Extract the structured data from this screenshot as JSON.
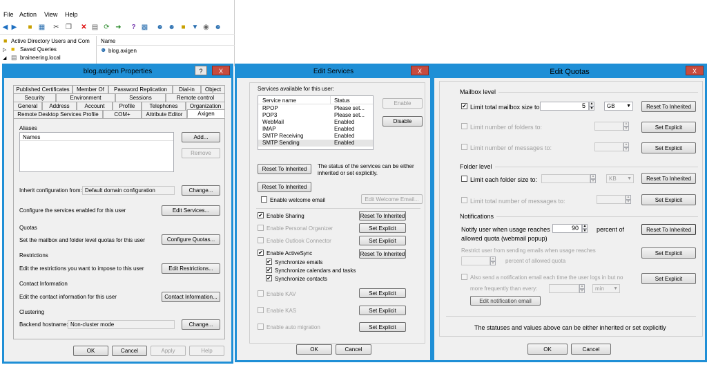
{
  "mmc": {
    "menu": [
      "File",
      "Action",
      "View",
      "Help"
    ],
    "tree": [
      "Active Directory Users and Com",
      "Saved Queries",
      "braineering.local"
    ],
    "list_header": "Name",
    "list_item": "blog.axigen"
  },
  "props": {
    "title": "blog.axigen Properties",
    "help_glyph": "?",
    "close_glyph": "X",
    "tabs_row1": [
      "Published Certificates",
      "Member Of",
      "Password Replication",
      "Dial-in",
      "Object"
    ],
    "tabs_row2": [
      "Security",
      "Environment",
      "Sessions",
      "Remote control"
    ],
    "tabs_row3": [
      "General",
      "Address",
      "Account",
      "Profile",
      "Telephones",
      "Organization"
    ],
    "tabs_row4": [
      "Remote Desktop Services Profile",
      "COM+",
      "Attribute Editor",
      "Axigen"
    ],
    "aliases_label": "Aliases",
    "names_header": "Names",
    "add": "Add...",
    "remove": "Remove",
    "inherit_label": "Inherit configuration from:",
    "inherit_value": "Default domain configuration",
    "change": "Change...",
    "services_text": "Configure the services enabled for this user",
    "edit_services": "Edit Services...",
    "quotas_label": "Quotas",
    "quotas_text": "Set the mailbox and  folder level quotas for this user",
    "configure_quotas": "Configure Quotas...",
    "restrictions_label": "Restrictions",
    "restrictions_text": "Edit the restrictions you want to impose to this user",
    "edit_restrictions": "Edit Restrictions...",
    "contact_label": "Contact Information",
    "contact_text": "Edit the contact information for this user",
    "contact_btn": "Contact Information...",
    "clustering_label": "Clustering",
    "backend_label": "Backend hostname:",
    "backend_value": "Non-cluster mode",
    "change2": "Change...",
    "ok": "OK",
    "cancel": "Cancel",
    "apply": "Apply",
    "help": "Help"
  },
  "services": {
    "title": "Edit Services",
    "close_glyph": "X",
    "avail_label": "Services available for this user:",
    "col_name": "Service name",
    "col_status": "Status",
    "rows": [
      {
        "name": "RPOP",
        "status": "Please set..."
      },
      {
        "name": "POP3",
        "status": "Please set..."
      },
      {
        "name": "WebMail",
        "status": "Enabled"
      },
      {
        "name": "IMAP",
        "status": "Enabled"
      },
      {
        "name": "SMTP Receiving",
        "status": "Enabled"
      },
      {
        "name": "SMTP Sending",
        "status": "Enabled"
      }
    ],
    "enable": "Enable",
    "disable": "Disable",
    "reset_inherited": "Reset To Inherited",
    "status_note": "The status of the services can be either inherited or set explicitly.",
    "reset_inherited2": "Reset To Inherited",
    "welcome_email": "Enable welcome email",
    "edit_welcome": "Edit Welcome Email...",
    "sharing": "Enable Sharing",
    "sharing_btn": "Reset To Inherited",
    "organizer": "Enable Personal Organizer",
    "organizer_btn": "Set Explicit",
    "outlook": "Enable Outlook Connector",
    "outlook_btn": "Set Explicit",
    "activesync": "Enable ActiveSync",
    "activesync_btn": "Reset To Inherited",
    "sync_emails": "Synchronize emails",
    "sync_calendars": "Synchronize calendars and tasks",
    "sync_contacts": "Synchronize contacts",
    "kav": "Enable KAV",
    "kav_btn": "Set Explicit",
    "kas": "Enable KAS",
    "kas_btn": "Set Explicit",
    "migration": "Enable auto migration",
    "migration_btn": "Set Explicit",
    "ok": "OK",
    "cancel": "Cancel"
  },
  "quotas": {
    "title": "Edit Quotas",
    "close_glyph": "X",
    "mailbox_level": "Mailbox level",
    "limit_mailbox": "Limit total mailbox size to:",
    "mailbox_value": "5",
    "mailbox_unit": "GB",
    "reset1": "Reset To Inherited",
    "limit_folders": "Limit number of folders to:",
    "set1": "Set Explicit",
    "limit_messages": "Limit number of messages to:",
    "set2": "Set Explicit",
    "folder_level": "Folder level",
    "limit_folder_size": "Limit each folder size to:",
    "folder_unit": "KB",
    "reset2": "Reset To Inherited",
    "limit_total_messages": "Limit total number of messages to:",
    "set3": "Set Explicit",
    "notifications": "Notifications",
    "notify_text1": "Notify user when usage reaches",
    "notify_value": "90",
    "notify_text2": "percent of",
    "notify_text3": "allowed quota (webmail popup)",
    "reset3": "Reset To Inherited",
    "restrict_text1": "Restrict user from sending emails when usage reaches",
    "restrict_text2": "percent of allowed quota",
    "set4": "Set Explicit",
    "also_text1": "Also send a notification email each time the user logs in but no",
    "also_text2": "more  frequently than every:",
    "also_unit": "min",
    "set5": "Set Explicit",
    "edit_notification": "Edit notification email",
    "footer": "The statuses and values above can be either inherited or set explicitly",
    "ok": "OK",
    "cancel": "Cancel"
  }
}
